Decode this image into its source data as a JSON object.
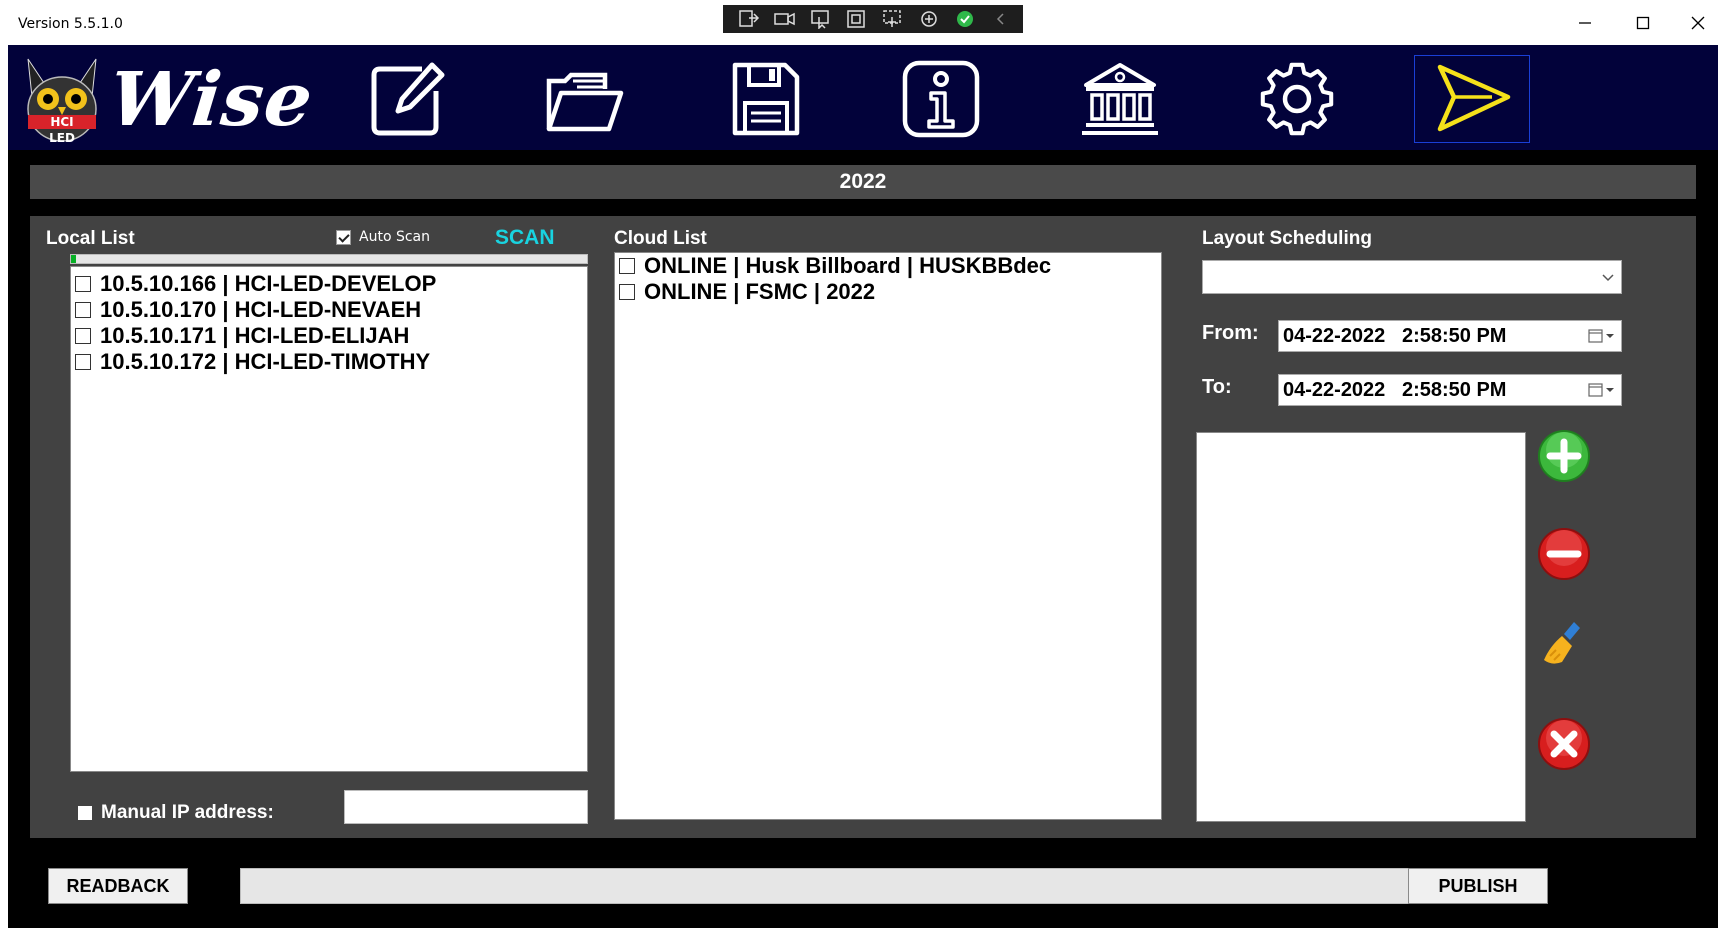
{
  "window": {
    "version": "Version 5.5.1.0",
    "app_name": "Wise",
    "logo_text_top": "HCI",
    "logo_text_bottom": "LED"
  },
  "toolbar": {
    "icons": [
      "edit-icon",
      "open-folder-icon",
      "save-icon",
      "info-icon",
      "bank-icon",
      "settings-icon",
      "send-icon"
    ]
  },
  "year_bar": {
    "label": "2022"
  },
  "local_list": {
    "title": "Local List",
    "auto_scan_label": "Auto Scan",
    "auto_scan_checked": true,
    "scan_label": "SCAN",
    "scan_progress": 0.01,
    "items": [
      {
        "label": "10.5.10.166 | HCI-LED-DEVELOP"
      },
      {
        "label": "10.5.10.170 | HCI-LED-NEVAEH"
      },
      {
        "label": "10.5.10.171 | HCI-LED-ELIJAH"
      },
      {
        "label": "10.5.10.172 | HCI-LED-TIMOTHY"
      }
    ],
    "manual_ip_label": "Manual IP address:",
    "manual_ip_value": ""
  },
  "cloud_list": {
    "title": "Cloud List",
    "items": [
      {
        "label": "ONLINE | Husk Billboard | HUSKBBdec"
      },
      {
        "label": "ONLINE | FSMC | 2022"
      }
    ]
  },
  "scheduling": {
    "title": "Layout Scheduling",
    "layout_selected": "",
    "from_label": "From:",
    "from_value": "04-22-2022   2:58:50 PM",
    "to_label": "To:",
    "to_value": "04-22-2022   2:58:50 PM"
  },
  "footer": {
    "readback_label": "READBACK",
    "publish_label": "PUBLISH"
  },
  "colors": {
    "header_bg": "#02023a",
    "panel_bg": "#424242",
    "scan_accent": "#19d3e0"
  }
}
